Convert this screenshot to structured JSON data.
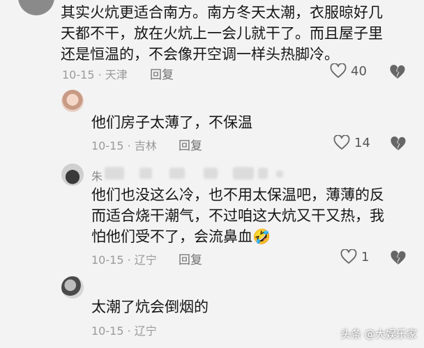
{
  "comments": [
    {
      "lines": [
        "其实火炕更适合南方。南方冬天太潮，衣服晾好几",
        "天都不干，放在火炕上一会儿就干了。而且屋子里",
        "还是恒温的，不会像开空调一样头热脚冷。"
      ],
      "date": "10-15",
      "location": "天津",
      "reply": "回复",
      "likes": "40"
    },
    {
      "lines": [
        "他们房子太薄了，不保温"
      ],
      "date": "10-15",
      "location": "吉林",
      "reply": "回复",
      "likes": "14"
    },
    {
      "name_prefix": "朱",
      "lines": [
        "他们也没这么冷，也不用太保温吧，薄薄的反",
        "而适合烧干潮气，不过咱这大炕又干又热，我",
        "怕他们受不了，会流鼻血"
      ],
      "emoji": "🤣",
      "date": "10-15",
      "location": "辽宁",
      "reply": "回复",
      "likes": "1"
    },
    {
      "lines": [
        "太潮了炕会倒烟的"
      ],
      "date": "10-15",
      "location": "辽宁",
      "reply": ""
    }
  ],
  "watermark": "头条 @大娱乐家",
  "icons": {
    "like": "heart-outline-icon",
    "dislike": "broken-heart-icon"
  },
  "colors": {
    "background": "#f3f3f3",
    "meta": "#9a9a9a"
  }
}
